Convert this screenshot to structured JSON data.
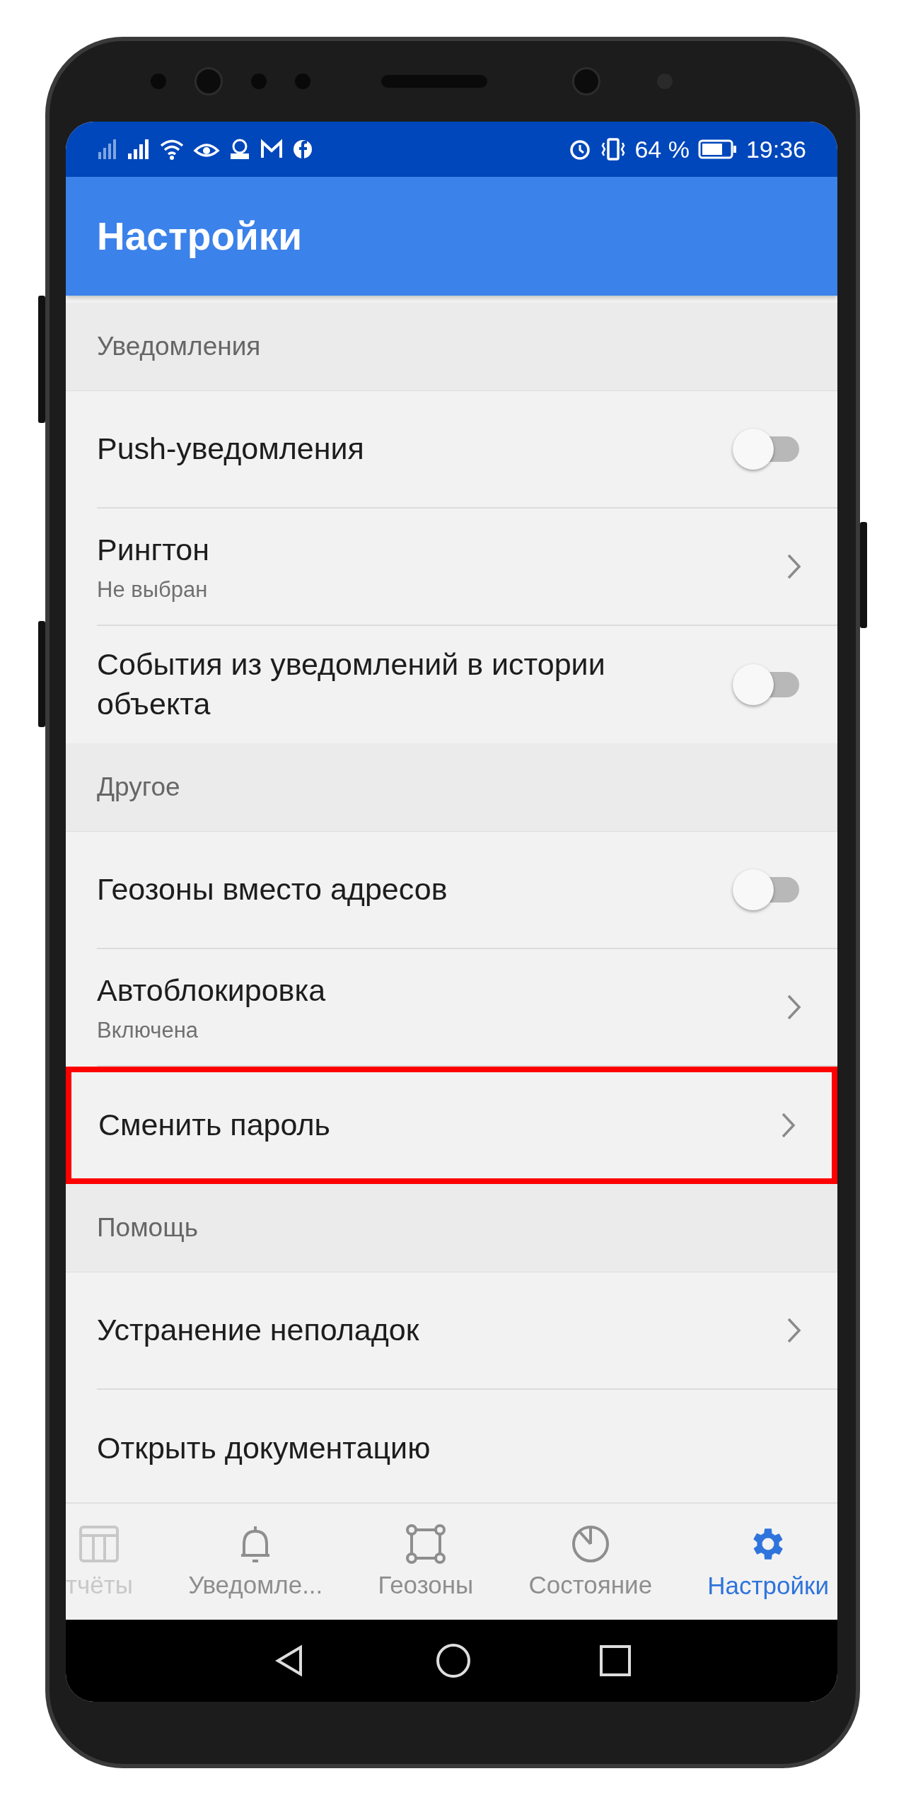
{
  "status_bar": {
    "battery": "64 %",
    "time": "19:36"
  },
  "app_bar": {
    "title": "Настройки"
  },
  "sections": [
    {
      "title": "Уведомления",
      "items": [
        {
          "kind": "toggle",
          "label": "Push-уведомления",
          "on": false
        },
        {
          "kind": "link",
          "label": "Рингтон",
          "subtitle": "Не выбран"
        },
        {
          "kind": "toggle",
          "label": "События из уведомлений в истории объекта",
          "on": false
        }
      ]
    },
    {
      "title": "Другое",
      "items": [
        {
          "kind": "toggle",
          "label": "Геозоны вместо адресов",
          "on": false
        },
        {
          "kind": "link",
          "label": "Автоблокировка",
          "subtitle": "Включена"
        },
        {
          "kind": "link",
          "label": "Сменить пароль",
          "highlighted": true
        }
      ]
    },
    {
      "title": "Помощь",
      "items": [
        {
          "kind": "link",
          "label": "Устранение неполадок"
        },
        {
          "kind": "plain",
          "label": "Открыть документацию"
        }
      ]
    }
  ],
  "bottom_nav": [
    {
      "kind": "table",
      "label": "тчёты",
      "selected": false
    },
    {
      "kind": "bell",
      "label": "Уведомле...",
      "selected": false
    },
    {
      "kind": "square",
      "label": "Геозоны",
      "selected": false
    },
    {
      "kind": "pie",
      "label": "Состояние",
      "selected": false
    },
    {
      "kind": "gear",
      "label": "Настройки",
      "selected": true
    }
  ]
}
